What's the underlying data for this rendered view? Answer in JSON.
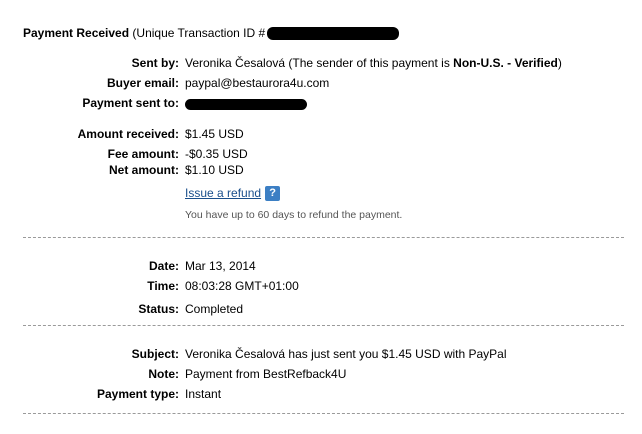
{
  "header": {
    "title": "Payment Received",
    "transaction_prefix": "(Unique Transaction ID #"
  },
  "details": {
    "sent_by_label": "Sent by:",
    "sent_by_name": "Veronika Česalová",
    "sent_by_note_pre": "(The sender of this payment is ",
    "sent_by_status": "Non-U.S. - Verified",
    "sent_by_note_post": ")",
    "buyer_email_label": "Buyer email:",
    "buyer_email": "paypal@bestaurora4u.com",
    "payment_sent_to_label": "Payment sent to:"
  },
  "amounts": {
    "received_label": "Amount received:",
    "received": "$1.45 USD",
    "fee_label": "Fee amount:",
    "fee": "-$0.35 USD",
    "net_label": "Net amount:",
    "net": "$1.10 USD",
    "refund_link": "Issue a refund",
    "refund_note": "You have up to 60 days to refund the payment."
  },
  "timing": {
    "date_label": "Date:",
    "date": "Mar 13, 2014",
    "time_label": "Time:",
    "time": "08:03:28 GMT+01:00",
    "status_label": "Status:",
    "status": "Completed"
  },
  "message": {
    "subject_label": "Subject:",
    "subject": "Veronika Česalová has just sent you $1.45 USD with PayPal",
    "note_label": "Note:",
    "note": "Payment from BestRefback4U",
    "payment_type_label": "Payment type:",
    "payment_type": "Instant"
  },
  "icons": {
    "help": "help-question-icon"
  },
  "colors": {
    "link": "#1a4f8c",
    "help_icon_bg": "#3c7fc4",
    "divider": "#9a9a9a"
  }
}
